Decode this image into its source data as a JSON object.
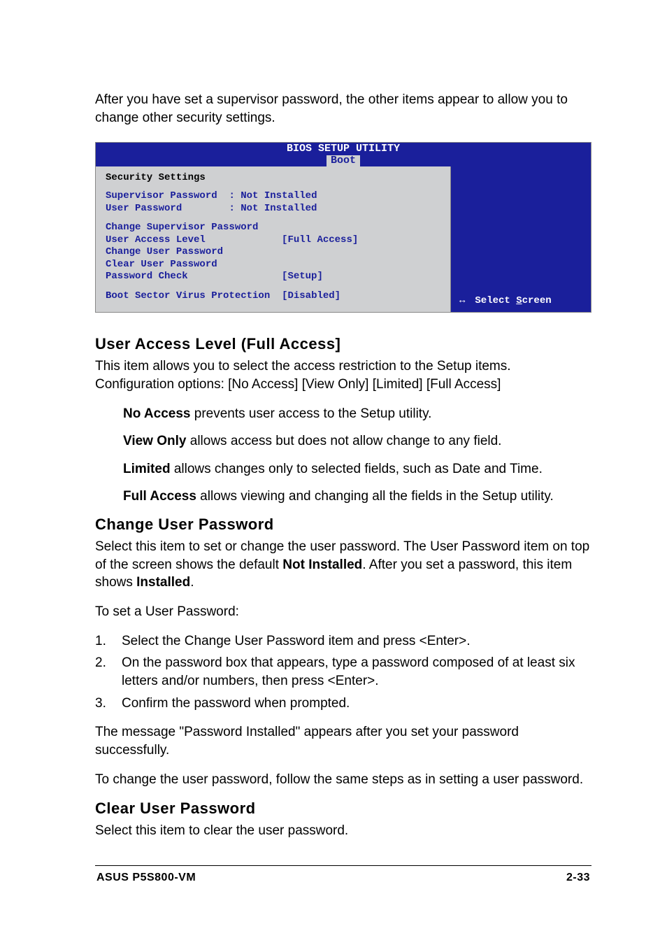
{
  "intro": "After you have set a supervisor password, the other items appear to allow you to change other security settings.",
  "bios": {
    "title": "BIOS SETUP UTILITY",
    "tab": "Boot",
    "section_title": "Security Settings",
    "status": {
      "supervisor_label": "Supervisor Password",
      "supervisor_value": ": Not Installed",
      "user_label": "User Password",
      "user_value": ": Not Installed"
    },
    "items": {
      "change_supervisor": "Change Supervisor Password",
      "user_access_level_label": "User Access Level",
      "user_access_level_value": "[Full Access]",
      "change_user": "Change User Password",
      "clear_user": "Clear User Password",
      "password_check_label": "Password Check",
      "password_check_value": "[Setup]",
      "boot_sector_label": "Boot Sector Virus Protection",
      "boot_sector_value": "[Disabled]"
    },
    "help": {
      "key": "↔",
      "label_prefix": "Select ",
      "label_underline": "S",
      "label_suffix": "creen"
    }
  },
  "ual": {
    "heading": "User Access Level (Full Access]",
    "desc": "This item allows you to select the access restriction to the Setup items. Configuration options: [No Access] [View Only] [Limited] [Full Access]",
    "options": [
      {
        "name": "No Access",
        "text": " prevents user access to the Setup utility."
      },
      {
        "name": "View Only",
        "text": " allows access but does not allow change to any field."
      },
      {
        "name": "Limited",
        "text": " allows changes only to selected fields, such as Date and Time."
      },
      {
        "name": "Full Access",
        "text": " allows viewing and changing all the fields in the Setup utility."
      }
    ]
  },
  "cup": {
    "heading": "Change User Password",
    "desc_pre": "Select this item to set or change the user password. The User Password item on top of the screen shows the default ",
    "desc_bold1": "Not Installed",
    "desc_mid": ". After you set a password, this item shows ",
    "desc_bold2": "Installed",
    "desc_post": ".",
    "to_set": "To set a User Password:",
    "steps": [
      {
        "n": "1.",
        "t": "Select the Change User Password item and press <Enter>."
      },
      {
        "n": "2.",
        "t": "On the password box that appears, type a password composed of at least six letters and/or numbers, then press <Enter>."
      },
      {
        "n": "3.",
        "t": "Confirm the password when prompted."
      }
    ],
    "success": "The message \"Password Installed\" appears after you set your password successfully.",
    "change": "To change the user password, follow the same steps as in setting a user password."
  },
  "clr": {
    "heading": "Clear User Password",
    "desc": "Select this item to clear the user password."
  },
  "footer": {
    "left": "ASUS P5S800-VM",
    "right": "2-33"
  }
}
